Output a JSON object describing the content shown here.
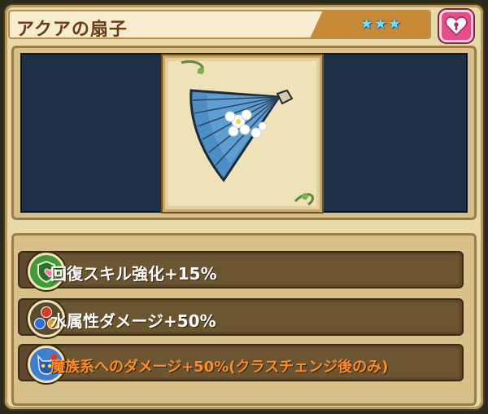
{
  "item": {
    "name": "アクアの扇子",
    "rarity_stars": "★★★"
  },
  "icons": {
    "favorite": "heart-lock-icon",
    "artwork": "folding-fan-icon"
  },
  "skills": [
    {
      "text": "回復スキル強化+15%",
      "icon": "heal-skill-icon",
      "color": "#ffffff"
    },
    {
      "text": "水属性ダメージ+50%",
      "icon": "element-icon",
      "color": "#ffffff"
    },
    {
      "text": "魔族系へのダメージ+50%(クラスチェンジ後のみ)",
      "icon": "demon-race-icon",
      "color": "#ff8c2a"
    }
  ]
}
